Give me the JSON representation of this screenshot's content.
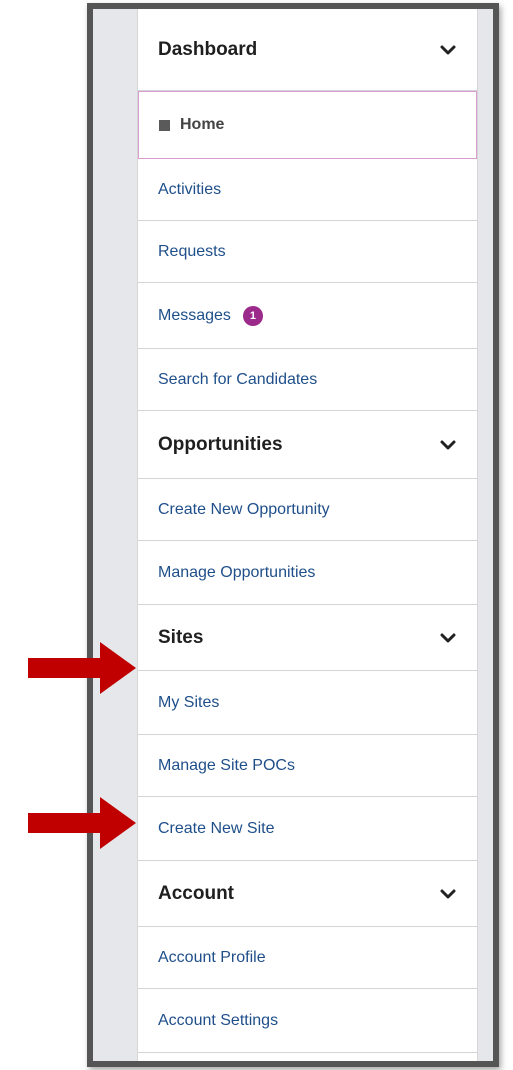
{
  "menu": {
    "dashboard": {
      "header": "Dashboard",
      "home": "Home",
      "activities": "Activities",
      "requests": "Requests",
      "messages": "Messages",
      "messages_badge": "1",
      "search_candidates": "Search for Candidates"
    },
    "opportunities": {
      "header": "Opportunities",
      "create_new": "Create New Opportunity",
      "manage": "Manage Opportunities"
    },
    "sites": {
      "header": "Sites",
      "my_sites": "My Sites",
      "manage_pocs": "Manage Site POCs",
      "create_new": "Create New Site"
    },
    "account": {
      "header": "Account",
      "profile": "Account Profile",
      "settings": "Account Settings"
    }
  },
  "colors": {
    "link": "#1f4f8a",
    "badge": "#9b2a8b",
    "arrow": "#c00000",
    "frame": "#555555"
  },
  "icons": [
    "chevron-down-icon",
    "home-square-icon",
    "red-arrow-icon"
  ]
}
